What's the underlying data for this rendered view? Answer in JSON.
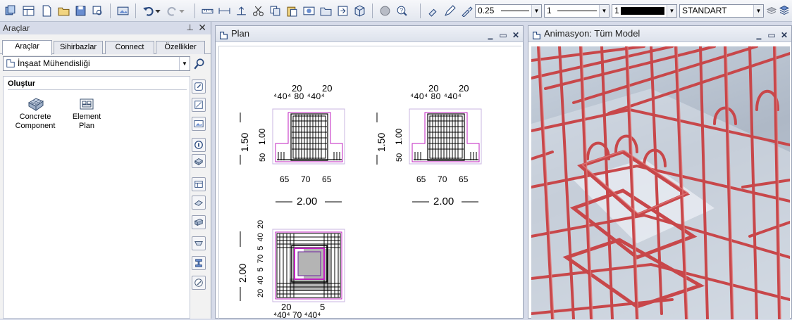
{
  "toolbar": {
    "pen_thickness": "0.25",
    "line_type": "1",
    "color": "1",
    "layer": "STANDART"
  },
  "left_panel": {
    "title": "Araçlar",
    "tabs": [
      "Araçlar",
      "Sihirbazlar",
      "Connect",
      "Özellikler"
    ],
    "module": "İnşaat Mühendisliği",
    "section": "Oluştur",
    "items": [
      {
        "label1": "Concrete",
        "label2": "Component"
      },
      {
        "label1": "Element",
        "label2": "Plan"
      }
    ]
  },
  "plan_window": {
    "title": "Plan"
  },
  "anim_window": {
    "title": "Animasyon: Tüm Model"
  },
  "drawing": {
    "a": {
      "top1": "20",
      "top2": "20",
      "row": "⁴40⁴   80   ⁴40⁴",
      "h_total": "1.50",
      "h_upper": "1.00",
      "h_lower": "50",
      "bottom": "65     70     65",
      "total": "2.00"
    },
    "b": {
      "top1": "20",
      "top2": "20",
      "row": "⁴40⁴   80   ⁴40⁴",
      "h_total": "1.50",
      "h_upper": "1.00",
      "h_lower": "50",
      "bottom": "65     70     65",
      "total": "2.00"
    },
    "c": {
      "v_total": "2.00",
      "v_dims": "20  40  5  70  5  40  20",
      "bot1": "20",
      "bot2": "5",
      "bottom": "⁴40⁴   70   ⁴40⁴"
    }
  }
}
